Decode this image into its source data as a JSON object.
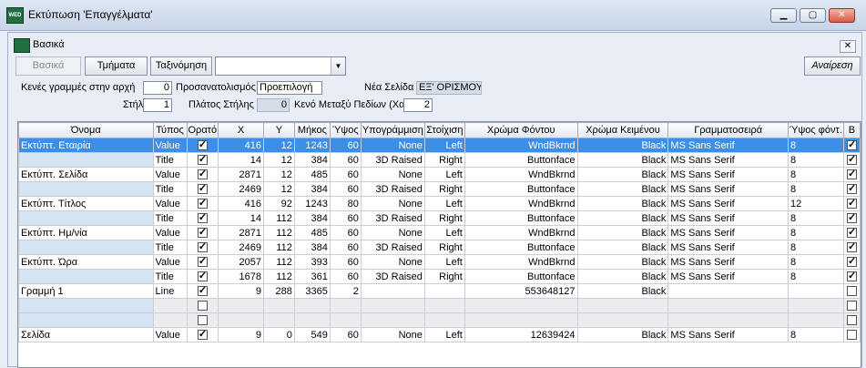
{
  "window": {
    "title": "Εκτύπωση 'Επαγγέλματα'",
    "app_icon": "wed-app-icon"
  },
  "panel": {
    "title": "Βασικά"
  },
  "toolbar": {
    "basic": "Βασικά",
    "sections": "Τμήματα",
    "sorting": "Ταξινόμηση",
    "combo_value": "",
    "refresh": "Αναίρεση"
  },
  "params": {
    "empty_rows_label": "Κενές γραμμές στην αρχή",
    "empty_rows_value": "0",
    "orientation_label": "Προσανατολισμός",
    "orientation_value": "Προεπιλογή",
    "new_page_label": "Νέα Σελίδα",
    "new_page_value": "ΕΞ' ΟΡΙΣΜΟΥ",
    "columns_label": "Στήλες",
    "columns_value": "1",
    "col_width_label": "Πλάτος Στήλης",
    "col_width_value": "0",
    "gap_label": "Κενό Μεταξύ Πεδίων (Χαρ.)",
    "gap_value": "2"
  },
  "grid": {
    "headers": [
      "Όνομα",
      "Τύπος",
      "Ορατό",
      "X",
      "Y",
      "Μήκος",
      "Ύψος",
      "Υπογράμμιση",
      "Στοίχιση",
      "Χρώμα Φόντου",
      "Χρώμα Κειμένου",
      "Γραμματοσειρά",
      "Ύψος φόντ.",
      "B"
    ],
    "rows": [
      {
        "name": "Εκτύπτ. Εταιρία",
        "type": "Value",
        "visible": true,
        "x": "416",
        "y": "12",
        "len": "1243",
        "h": "60",
        "under": "None",
        "align": "Left",
        "bg": "WndBkrnd",
        "fg": "Black",
        "font": "MS Sans Serif",
        "fs": "8",
        "b": true,
        "selected": true
      },
      {
        "name": "",
        "type": "Title",
        "visible": true,
        "x": "14",
        "y": "12",
        "len": "384",
        "h": "60",
        "under": "3D Raised",
        "align": "Right",
        "bg": "Buttonface",
        "fg": "Black",
        "font": "MS Sans Serif",
        "fs": "8",
        "b": true
      },
      {
        "name": "Εκτύπτ. Σελίδα",
        "type": "Value",
        "visible": true,
        "x": "2871",
        "y": "12",
        "len": "485",
        "h": "60",
        "under": "None",
        "align": "Left",
        "bg": "WndBkrnd",
        "fg": "Black",
        "font": "MS Sans Serif",
        "fs": "8",
        "b": true
      },
      {
        "name": "",
        "type": "Title",
        "visible": true,
        "x": "2469",
        "y": "12",
        "len": "384",
        "h": "60",
        "under": "3D Raised",
        "align": "Right",
        "bg": "Buttonface",
        "fg": "Black",
        "font": "MS Sans Serif",
        "fs": "8",
        "b": true
      },
      {
        "name": "Εκτύπτ. Τίτλος",
        "type": "Value",
        "visible": true,
        "x": "416",
        "y": "92",
        "len": "1243",
        "h": "80",
        "under": "None",
        "align": "Left",
        "bg": "WndBkrnd",
        "fg": "Black",
        "font": "MS Sans Serif",
        "fs": "12",
        "b": true
      },
      {
        "name": "",
        "type": "Title",
        "visible": true,
        "x": "14",
        "y": "112",
        "len": "384",
        "h": "60",
        "under": "3D Raised",
        "align": "Right",
        "bg": "Buttonface",
        "fg": "Black",
        "font": "MS Sans Serif",
        "fs": "8",
        "b": true
      },
      {
        "name": "Εκτύπτ. Ημ/νία",
        "type": "Value",
        "visible": true,
        "x": "2871",
        "y": "112",
        "len": "485",
        "h": "60",
        "under": "None",
        "align": "Left",
        "bg": "WndBkrnd",
        "fg": "Black",
        "font": "MS Sans Serif",
        "fs": "8",
        "b": true
      },
      {
        "name": "",
        "type": "Title",
        "visible": true,
        "x": "2469",
        "y": "112",
        "len": "384",
        "h": "60",
        "under": "3D Raised",
        "align": "Right",
        "bg": "Buttonface",
        "fg": "Black",
        "font": "MS Sans Serif",
        "fs": "8",
        "b": true
      },
      {
        "name": "Εκτύπτ. Ώρα",
        "type": "Value",
        "visible": true,
        "x": "2057",
        "y": "112",
        "len": "393",
        "h": "60",
        "under": "None",
        "align": "Left",
        "bg": "WndBkrnd",
        "fg": "Black",
        "font": "MS Sans Serif",
        "fs": "8",
        "b": true
      },
      {
        "name": "",
        "type": "Title",
        "visible": true,
        "x": "1678",
        "y": "112",
        "len": "361",
        "h": "60",
        "under": "3D Raised",
        "align": "Right",
        "bg": "Buttonface",
        "fg": "Black",
        "font": "MS Sans Serif",
        "fs": "8",
        "b": true
      },
      {
        "name": "Γραμμή 1",
        "type": "Line",
        "visible": true,
        "x": "9",
        "y": "288",
        "len": "3365",
        "h": "2",
        "under": "",
        "align": "",
        "bg": "553648127",
        "fg": "Black",
        "font": "",
        "fs": "",
        "b": false
      },
      {
        "name": "",
        "type": "",
        "visible": false,
        "x": "",
        "y": "",
        "len": "",
        "h": "",
        "under": "",
        "align": "",
        "bg": "",
        "fg": "",
        "font": "",
        "fs": "",
        "b": false,
        "blank": true
      },
      {
        "name": "",
        "type": "",
        "visible": false,
        "x": "",
        "y": "",
        "len": "",
        "h": "",
        "under": "",
        "align": "",
        "bg": "",
        "fg": "",
        "font": "",
        "fs": "",
        "b": false,
        "blank": true
      },
      {
        "name": "Σελίδα",
        "type": "Value",
        "visible": true,
        "x": "9",
        "y": "0",
        "len": "549",
        "h": "60",
        "under": "None",
        "align": "Left",
        "bg": "12639424",
        "fg": "Black",
        "font": "MS Sans Serif",
        "fs": "8",
        "b": false
      }
    ]
  }
}
